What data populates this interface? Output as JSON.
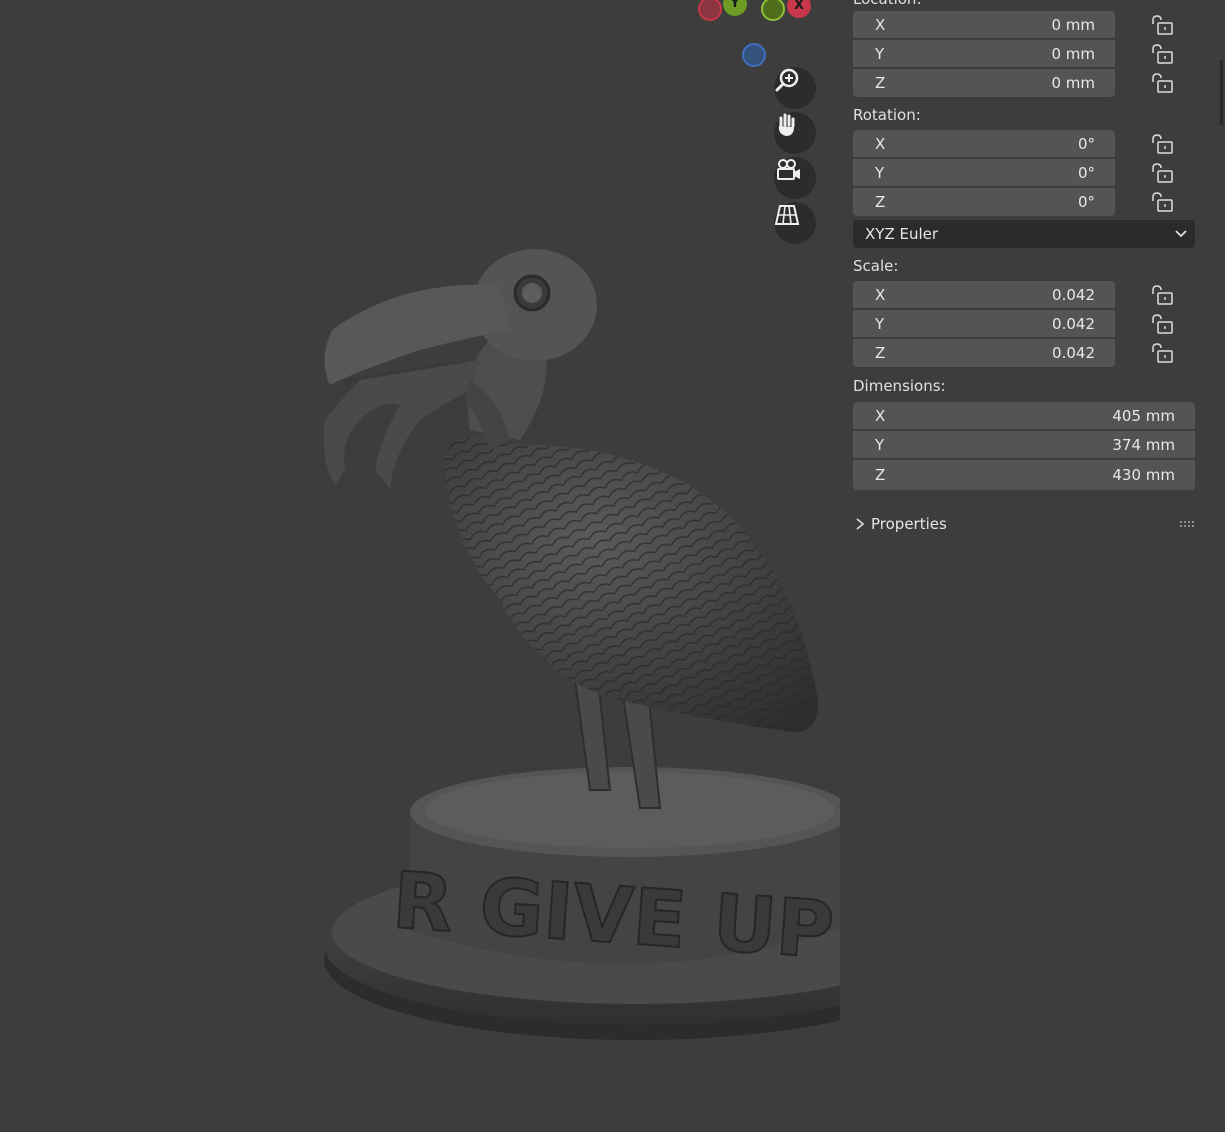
{
  "sidebar": {
    "location": {
      "label": "Location:",
      "x": {
        "axis": "X",
        "value": "0 mm"
      },
      "y": {
        "axis": "Y",
        "value": "0 mm"
      },
      "z": {
        "axis": "Z",
        "value": "0 mm"
      }
    },
    "rotation": {
      "label": "Rotation:",
      "x": {
        "axis": "X",
        "value": "0°"
      },
      "y": {
        "axis": "Y",
        "value": "0°"
      },
      "z": {
        "axis": "Z",
        "value": "0°"
      },
      "mode": "XYZ Euler"
    },
    "scale": {
      "label": "Scale:",
      "x": {
        "axis": "X",
        "value": "0.042"
      },
      "y": {
        "axis": "Y",
        "value": "0.042"
      },
      "z": {
        "axis": "Z",
        "value": "0.042"
      }
    },
    "dimensions": {
      "label": "Dimensions:",
      "x": {
        "axis": "X",
        "value": "405 mm"
      },
      "y": {
        "axis": "Y",
        "value": "374 mm"
      },
      "z": {
        "axis": "Z",
        "value": "430 mm"
      }
    },
    "properties_label": "Properties"
  },
  "gizmo": {
    "y_label": "Y",
    "x_label": "X"
  },
  "model": {
    "base_text": "R GIVE UP!"
  },
  "colors": {
    "panel_bg": "#3d3d3d",
    "field_bg": "#545454",
    "axis_x": "#c8374a",
    "axis_y": "#6d9b23",
    "axis_z": "#3f6fbf"
  }
}
